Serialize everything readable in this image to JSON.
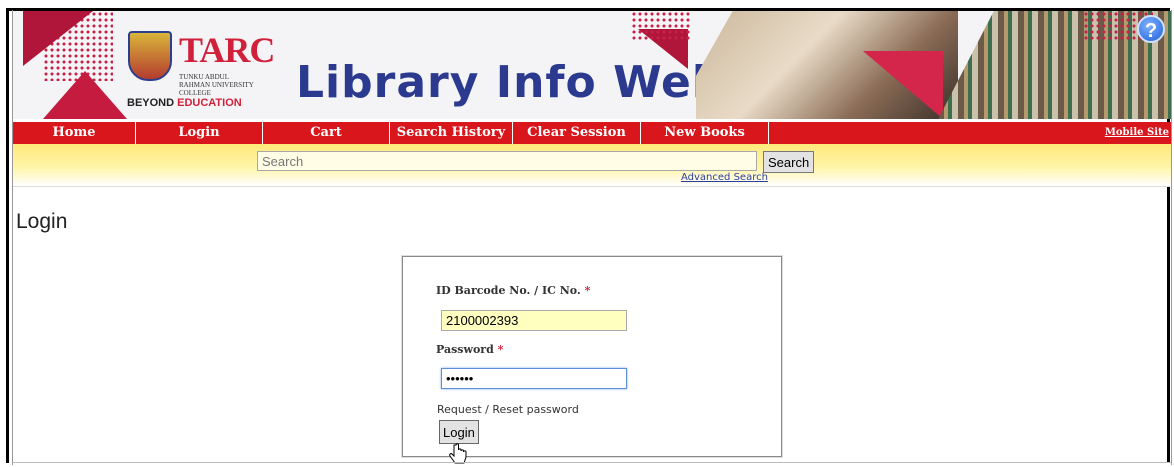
{
  "banner": {
    "org_short": "TARC",
    "org_full": "TUNKU ABDUL RAHMAN UNIVERSITY COLLEGE",
    "tagline_part1": "BEYOND ",
    "tagline_part2": "EDUCATION",
    "site_title": "Library Info Web",
    "help_symbol": "?"
  },
  "nav": {
    "items": [
      {
        "label": "Home"
      },
      {
        "label": "Login"
      },
      {
        "label": "Cart"
      },
      {
        "label": "Search History"
      },
      {
        "label": "Clear Session"
      },
      {
        "label": "New Books"
      }
    ],
    "mobile_site": "Mobile Site"
  },
  "search": {
    "placeholder": "Search",
    "button": "Search",
    "advanced": "Advanced Search"
  },
  "page": {
    "title": "Login"
  },
  "login": {
    "id_label": "ID Barcode No. / IC No.",
    "id_value": "2100002393",
    "password_label": "Password",
    "password_value": "••••••",
    "required_mark": "*",
    "reset_link": "Request / Reset password",
    "login_button": "Login"
  },
  "colors": {
    "nav_red": "#d8161c",
    "title_blue": "#2b3a8f",
    "brand_red": "#d0203a"
  }
}
